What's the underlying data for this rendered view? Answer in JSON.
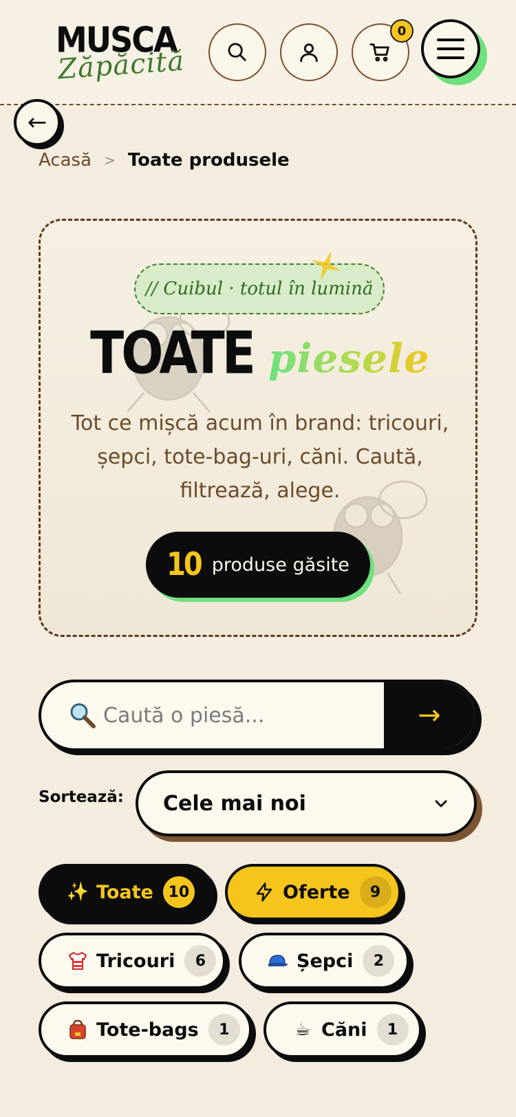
{
  "header": {
    "logo_top": "MUSCA",
    "logo_bottom": "Zăpăcită",
    "cart_count": "0",
    "icons": [
      "search-icon",
      "user-icon",
      "cart-icon",
      "menu-icon"
    ]
  },
  "nav": {
    "back_glyph": "←"
  },
  "breadcrumb": {
    "home": "Acasă",
    "separator": ">",
    "current": "Toate produsele"
  },
  "hero": {
    "tag": "// Cuibul · totul în lumină",
    "title_main": "TOATE",
    "title_accent": "piesele",
    "description": "Tot ce mișcă acum în brand: tricouri, șepci, tote-bag-uri, căni. Caută, filtrează, alege.",
    "count_number": "10",
    "count_label": "produse găsite"
  },
  "search": {
    "placeholder": "Caută o piesă...",
    "go_glyph": "→"
  },
  "sort": {
    "label": "Sortează:",
    "selected": "Cele mai noi"
  },
  "categories": [
    {
      "label": "Toate",
      "count": "10",
      "icon": "sparkles-icon",
      "glyph": "✨"
    },
    {
      "label": "Oferte",
      "count": "9",
      "icon": "lightning-icon",
      "glyph": ""
    },
    {
      "label": "Tricouri",
      "count": "6",
      "icon": "tshirt-icon",
      "glyph": ""
    },
    {
      "label": "Șepci",
      "count": "2",
      "icon": "cap-icon",
      "glyph": ""
    },
    {
      "label": "Tote-bags",
      "count": "1",
      "icon": "bag-icon",
      "glyph": ""
    },
    {
      "label": "Căni",
      "count": "1",
      "icon": "mug-icon",
      "glyph": "☕"
    }
  ],
  "colors": {
    "accent_yellow": "#f5c51e",
    "accent_green": "#6ee07e",
    "brown": "#6b4a2b",
    "ink": "#0c0c0c",
    "paper": "#f3ecdf"
  }
}
